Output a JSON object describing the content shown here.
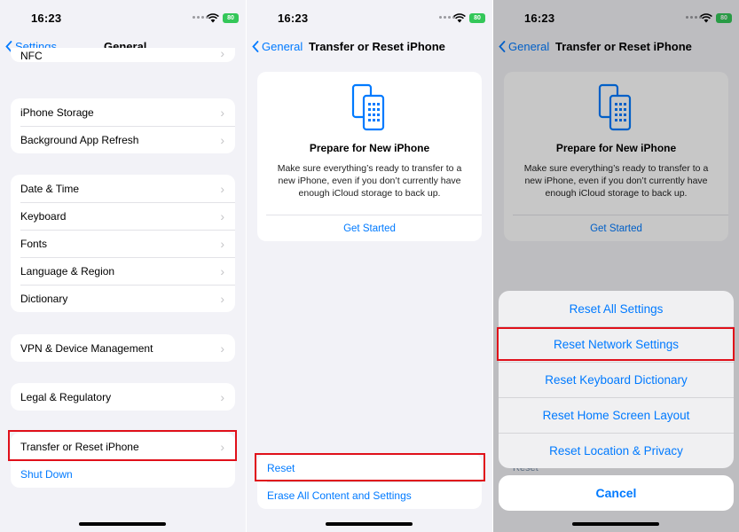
{
  "status": {
    "time": "16:23",
    "battery": "80"
  },
  "screen1": {
    "back_label": "Settings",
    "title": "General",
    "partial_item": "NFC",
    "groups": [
      [
        "iPhone Storage",
        "Background App Refresh"
      ],
      [
        "Date & Time",
        "Keyboard",
        "Fonts",
        "Language & Region",
        "Dictionary"
      ],
      [
        "VPN & Device Management"
      ],
      [
        "Legal & Regulatory"
      ]
    ],
    "transfer_item": "Transfer or Reset iPhone",
    "shutdown_item": "Shut Down"
  },
  "screen2": {
    "back_label": "General",
    "title": "Transfer or Reset iPhone",
    "card": {
      "title": "Prepare for New iPhone",
      "description": "Make sure everything’s ready to transfer to a new iPhone, even if you don’t currently have enough iCloud storage to back up.",
      "button": "Get Started"
    },
    "reset_label": "Reset",
    "erase_label": "Erase All Content and Settings"
  },
  "screen3": {
    "sheet_options": [
      "Reset All Settings",
      "Reset Network Settings",
      "Reset Keyboard Dictionary",
      "Reset Home Screen Layout",
      "Reset Location & Privacy"
    ],
    "cancel_label": "Cancel",
    "peek_text": "Reset"
  },
  "colors": {
    "accent": "#007aff",
    "highlight": "#e0101a",
    "battery": "#34c759"
  },
  "icons": [
    "chevron-left-icon",
    "chevron-right-icon",
    "wifi-icon",
    "signal-dots-icon",
    "battery-icon",
    "phone-transfer-icon"
  ]
}
